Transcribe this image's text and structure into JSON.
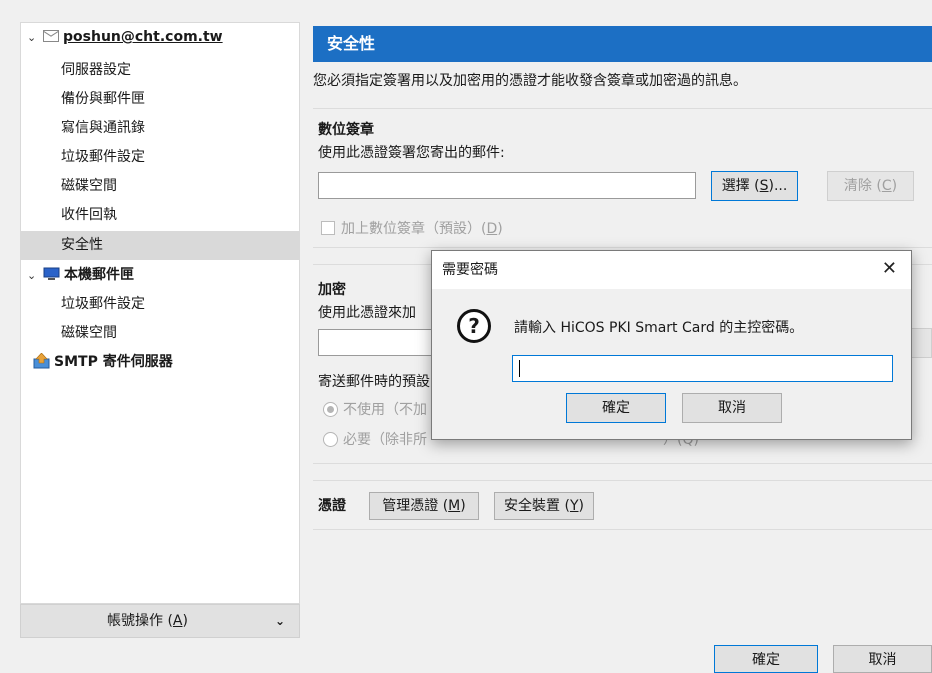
{
  "sidebar": {
    "account_email": "poshun@cht.com.tw",
    "account_items": [
      "伺服器設定",
      "備份與郵件匣",
      "寫信與通訊錄",
      "垃圾郵件設定",
      "磁碟空間",
      "收件回執",
      "安全性"
    ],
    "local_folders": "本機郵件匣",
    "local_items": [
      "垃圾郵件設定",
      "磁碟空間"
    ],
    "smtp": "SMTP 寄件伺服器",
    "account_actions": {
      "label": "帳號操作 (",
      "key": "A",
      "suffix": ")"
    }
  },
  "main": {
    "header": "安全性",
    "intro": "您必須指定簽署用以及加密用的憑證才能收發含簽章或加密過的訊息。",
    "signing": {
      "title": "數位簽章",
      "desc": "使用此憑證簽署您寄出的郵件:",
      "select_btn": {
        "label": "選擇 (",
        "key": "S",
        "suffix": ")..."
      },
      "clear_btn": {
        "label": "清除 (",
        "key": "C",
        "suffix": ")"
      },
      "checkbox": {
        "label": "加上數位簽章（預設）(",
        "key": "D",
        "suffix": ")"
      }
    },
    "encryption": {
      "title": "加密",
      "desc": "使用此憑證來加",
      "default_text": "寄送郵件時的預設",
      "radio_never": "不使用（不加",
      "radio_required_left": "必要（除非所",
      "radio_required_right": "）(Q)"
    },
    "certificates": {
      "title": "憑證",
      "manage_btn": {
        "label": "管理憑證 (",
        "key": "M",
        "suffix": ")"
      },
      "devices_btn": {
        "label": "安全裝置 (",
        "key": "Y",
        "suffix": ")"
      }
    }
  },
  "dialog": {
    "title": "需要密碼",
    "close": "✕",
    "icon": "?",
    "message": "請輸入 HiCOS PKI Smart Card 的主控密碼。",
    "ok": "確定",
    "cancel": "取消"
  },
  "footer": {
    "ok": "確定",
    "cancel": "取消"
  }
}
